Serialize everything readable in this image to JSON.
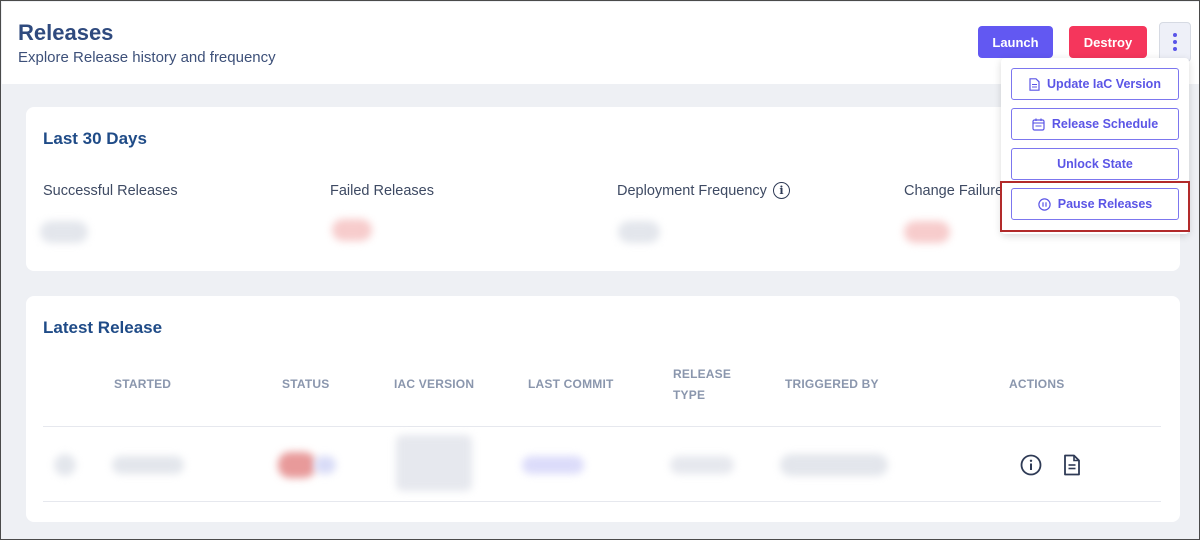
{
  "header": {
    "title": "Releases",
    "subtitle": "Explore Release history and frequency",
    "launch_label": "Launch",
    "destroy_label": "Destroy",
    "more_icon": "kebab-vertical-icon"
  },
  "colors": {
    "primary": "#6258f2",
    "danger": "#f5365c",
    "heading": "#1f4b87",
    "highlight": "#b22a2a"
  },
  "last30": {
    "title": "Last 30 Days",
    "stats": [
      {
        "label": "Successful Releases"
      },
      {
        "label": "Failed Releases"
      },
      {
        "label": "Deployment Frequency",
        "icon": "info-icon"
      },
      {
        "label": "Change Failure"
      }
    ]
  },
  "latest": {
    "title": "Latest Release",
    "columns": [
      "STARTED",
      "STATUS",
      "IAC VERSION",
      "LAST COMMIT",
      "RELEASE TYPE",
      "TRIGGERED BY",
      "ACTIONS"
    ],
    "action_icons": [
      "info-icon",
      "document-icon"
    ]
  },
  "menu": {
    "items": [
      {
        "label": "Update IaC Version",
        "icon": "document-icon"
      },
      {
        "label": "Release Schedule",
        "icon": "calendar-icon"
      },
      {
        "label": "Unlock State",
        "icon": ""
      },
      {
        "label": "Pause Releases",
        "icon": "pause-circle-icon",
        "highlighted": true
      }
    ]
  }
}
